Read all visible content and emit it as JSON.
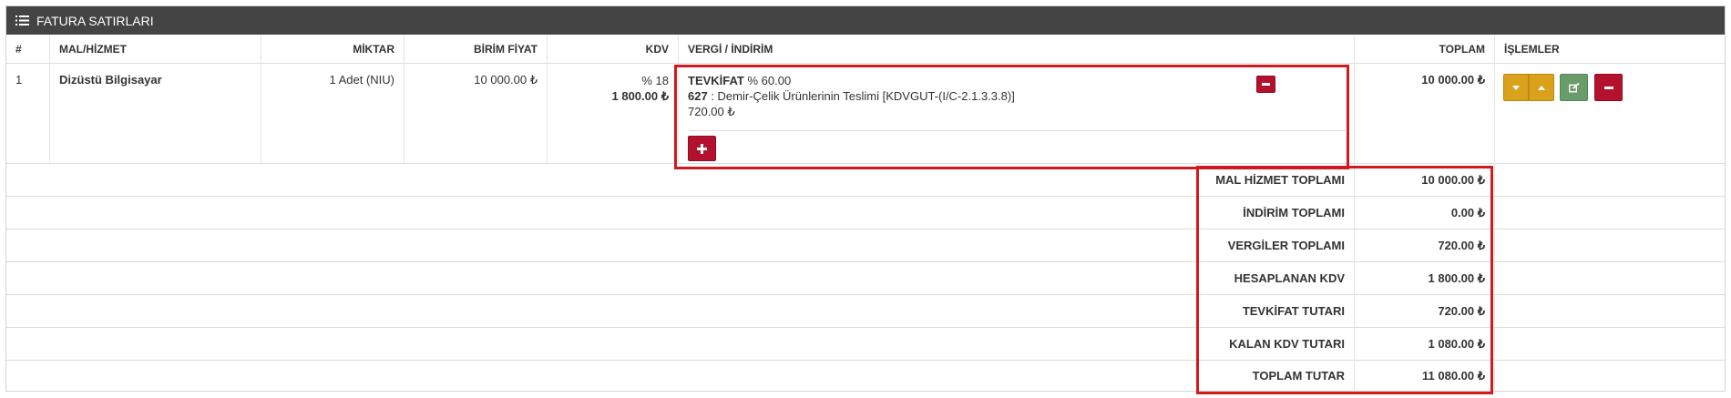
{
  "panel": {
    "title": "FATURA SATIRLARI",
    "title_icon": "list-icon"
  },
  "columns": {
    "num": "#",
    "item": "MAL/HİZMET",
    "qty": "MİKTAR",
    "unit_price": "BİRİM FİYAT",
    "kdv": "KDV",
    "tax": "VERGİ / İNDİRİM",
    "total": "TOPLAM",
    "actions": "İŞLEMLER"
  },
  "row": {
    "num": "1",
    "item": "Dizüstü Bilgisayar",
    "qty": "1 Adet (NIU)",
    "unit_price": "10 000.00 ₺",
    "kdv_rate": "% 18",
    "kdv_amount": "1 800.00 ₺",
    "tax_name": "TEVKİFAT",
    "tax_rate": " % 60.00",
    "tax_code": "627",
    "tax_desc": " : Demir-Çelik Ürünlerinin Teslimi [KDVGUT-(I/C-2.1.3.3.8)]",
    "tax_amount": "720.00 ₺",
    "total": "10 000.00 ₺"
  },
  "summary": [
    {
      "label": "MAL HİZMET TOPLAMI",
      "value": "10 000.00 ₺"
    },
    {
      "label": "İNDİRİM TOPLAMI",
      "value": "0.00 ₺"
    },
    {
      "label": "VERGİLER TOPLAMI",
      "value": "720.00 ₺"
    },
    {
      "label": "HESAPLANAN KDV",
      "value": "1 800.00 ₺"
    },
    {
      "label": "TEVKİFAT TUTARI",
      "value": "720.00 ₺"
    },
    {
      "label": "KALAN KDV TUTARI",
      "value": "1 080.00 ₺"
    },
    {
      "label": "TOPLAM TUTAR",
      "value": "11 080.00 ₺"
    }
  ],
  "icons": {
    "remove_tax": "minus-icon",
    "add_tax": "plus-icon",
    "move_down": "caret-down-icon",
    "move_up": "caret-up-icon",
    "edit": "edit-icon",
    "delete": "minus-icon"
  },
  "colors": {
    "header_bg": "#444444",
    "danger": "#b3112e",
    "warning": "#daa11a",
    "success": "#6a9b6a",
    "highlight_box": "#d11a1f"
  }
}
